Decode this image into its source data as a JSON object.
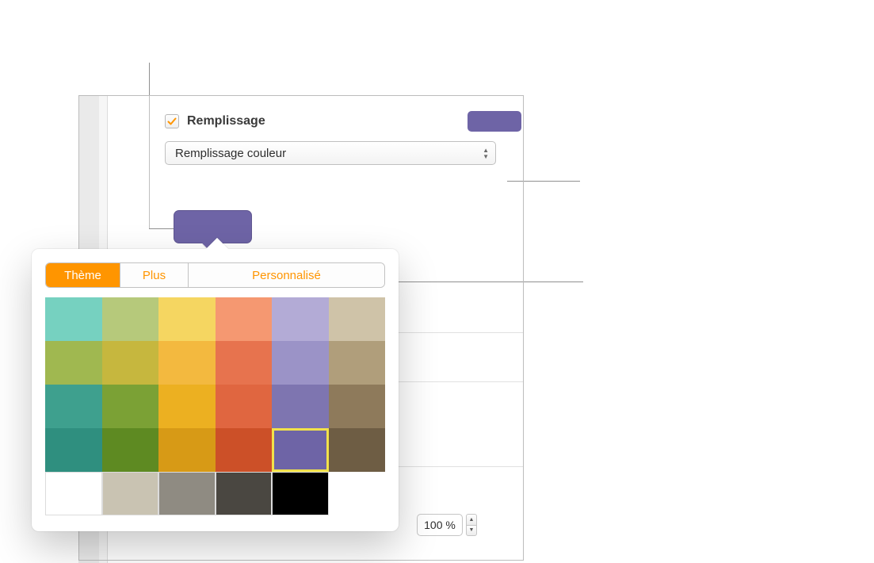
{
  "inspector": {
    "fill_checkbox_checked": true,
    "fill_label": "Remplissage",
    "fill_type_value": "Remplissage couleur",
    "current_fill_color": "#6e64a6"
  },
  "popover": {
    "tabs": {
      "theme": "Thème",
      "more": "Plus",
      "custom": "Personnalisé"
    },
    "swatch_rows": [
      [
        "#76d1c0",
        "#b6c97b",
        "#f5d661",
        "#f59871",
        "#b3abd6",
        "#cfc3a8"
      ],
      [
        "#a0b850",
        "#c6b73e",
        "#f3b93f",
        "#e7734e",
        "#9b93c7",
        "#b09e7b"
      ],
      [
        "#3ea08e",
        "#7ba135",
        "#ecb021",
        "#e06640",
        "#7e75b0",
        "#8e7a5b"
      ],
      [
        "#2f8f7f",
        "#5e8a22",
        "#d79a16",
        "#cc5028",
        "#6e64a6",
        "#6e5d44"
      ],
      [
        "#ffffff",
        "#c9c3b2",
        "#8f8b82",
        "#4a4741",
        "#000000",
        ""
      ]
    ],
    "selected_swatch": "3-4"
  },
  "opacity": {
    "value": "100 %"
  },
  "icons": {
    "checkmark": "checkmark-icon",
    "chevrons": "chevrons-up-down-icon",
    "step_up": "stepper-up-icon",
    "step_down": "stepper-down-icon"
  }
}
